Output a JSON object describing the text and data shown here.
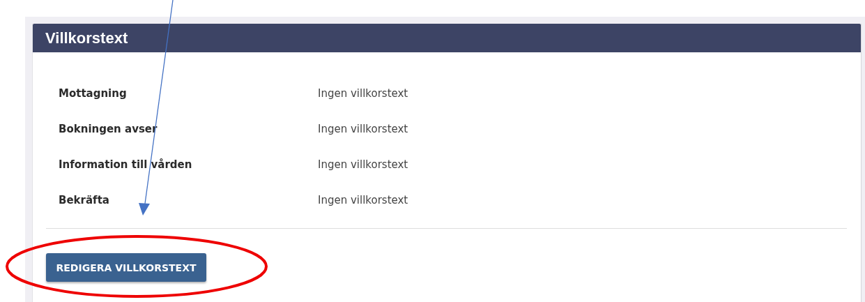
{
  "panel": {
    "title": "Villkorstext",
    "rows": [
      {
        "label": "Mottagning",
        "value": "Ingen villkorstext"
      },
      {
        "label": "Bokningen avser",
        "value": "Ingen villkorstext"
      },
      {
        "label": "Information till vården",
        "value": "Ingen villkorstext"
      },
      {
        "label": "Bekräfta",
        "value": "Ingen villkorstext"
      }
    ],
    "button": "REDIGERA VILLKORSTEXT"
  }
}
